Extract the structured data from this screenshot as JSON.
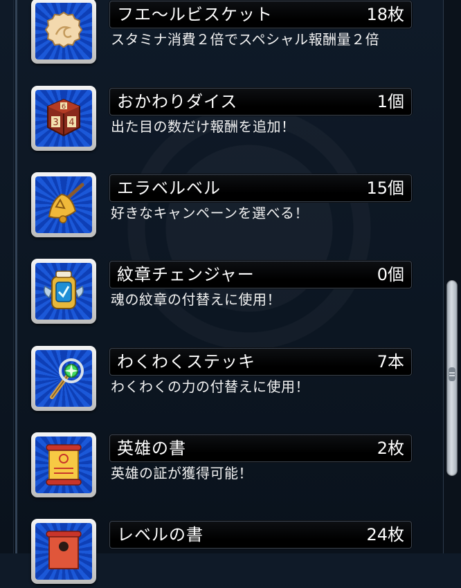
{
  "items": [
    {
      "name": "フエ〜ルビスケット",
      "qty": "18枚",
      "desc": "スタミナ消費２倍でスペシャル報酬量２倍",
      "icon": "biscuit-icon"
    },
    {
      "name": "おかわりダイス",
      "qty": "1個",
      "desc": "出た目の数だけ報酬を追加！",
      "icon": "dice-icon"
    },
    {
      "name": "エラベルベル",
      "qty": "15個",
      "desc": "好きなキャンペーンを選べる！",
      "icon": "bell-icon"
    },
    {
      "name": "紋章チェンジャー",
      "qty": "0個",
      "desc": "魂の紋章の付替えに使用！",
      "icon": "crest-changer-icon"
    },
    {
      "name": "わくわくステッキ",
      "qty": "7本",
      "desc": "わくわくの力の付替えに使用！",
      "icon": "wand-icon"
    },
    {
      "name": "英雄の書",
      "qty": "2枚",
      "desc": "英雄の証が獲得可能！",
      "icon": "scroll-icon"
    },
    {
      "name": "レベルの書",
      "qty": "24枚",
      "desc": "",
      "icon": "scroll-red-icon"
    }
  ],
  "dice_faces": [
    "6",
    "3",
    "4"
  ]
}
